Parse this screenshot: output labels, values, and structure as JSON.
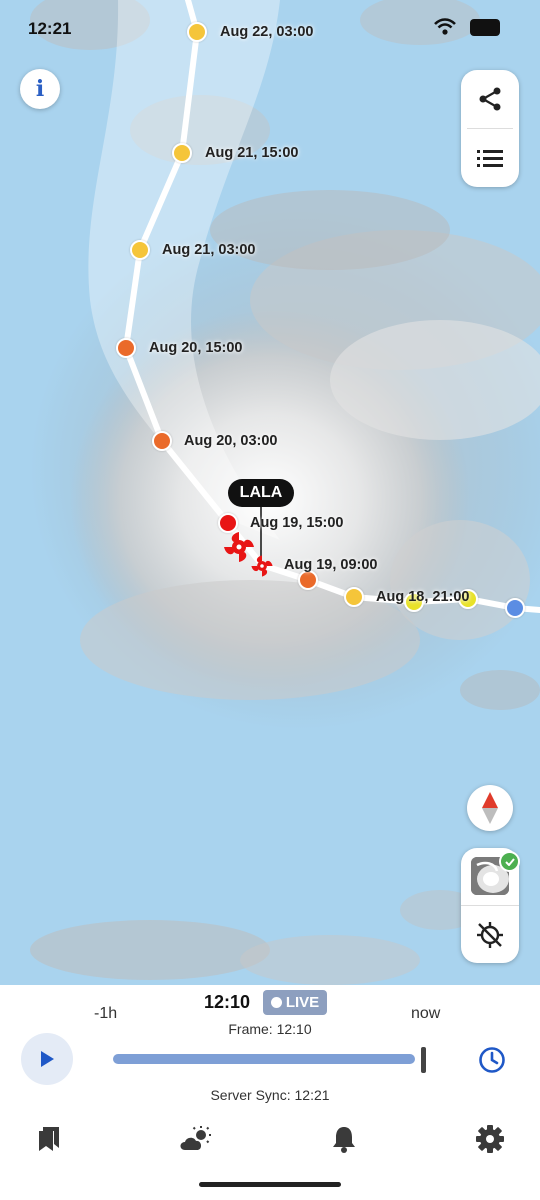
{
  "status_bar": {
    "time": "12:21"
  },
  "map": {
    "storm_name": "LALA",
    "track_points": [
      {
        "label": "Aug 22, 03:00",
        "color": "#f5c53a"
      },
      {
        "label": "Aug 21, 15:00",
        "color": "#f5c53a"
      },
      {
        "label": "Aug 21, 03:00",
        "color": "#f5c53a"
      },
      {
        "label": "Aug 20, 15:00",
        "color": "#ea6a2a"
      },
      {
        "label": "Aug 20, 03:00",
        "color": "#ea6a2a"
      },
      {
        "label": "Aug 19, 15:00",
        "color": "#e81515"
      },
      {
        "label": "Aug 19, 09:00",
        "color": "#ea6a2a"
      },
      {
        "label": "Aug 18, 21:00",
        "color": "#e8e227"
      }
    ],
    "past_point_color": "#f5c53a",
    "origin_point_color": "#5b8de3"
  },
  "buttons": {
    "info": "i",
    "share": "share-icon",
    "list": "list-icon",
    "compass": "compass-icon",
    "layers": "radar-layer-icon",
    "locate": "location-disabled-icon"
  },
  "timeline": {
    "start_label": "-1h",
    "end_label": "now",
    "current_time": "12:10",
    "live_label": "LIVE",
    "frame_label": "Frame: 12:10",
    "progress": 0.98,
    "server_sync": "Server Sync: 12:21"
  },
  "nav": [
    "bookmarks-icon",
    "weather-icon",
    "alerts-icon",
    "settings-icon"
  ],
  "colors": {
    "accent": "#1f58c7",
    "live_badge": "#8d9fbf",
    "map_water": "#a9d3ee"
  }
}
